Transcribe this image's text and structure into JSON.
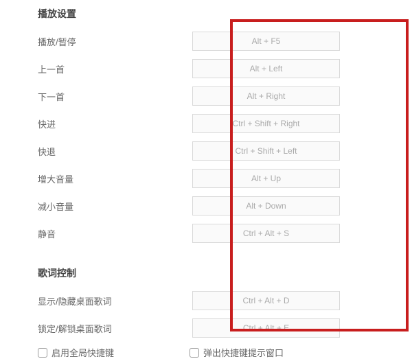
{
  "playback": {
    "title": "播放设置",
    "items": [
      {
        "label": "播放/暂停",
        "shortcut": "Alt + F5"
      },
      {
        "label": "上一首",
        "shortcut": "Alt + Left"
      },
      {
        "label": "下一首",
        "shortcut": "Alt + Right"
      },
      {
        "label": "快进",
        "shortcut": "Ctrl + Shift + Right"
      },
      {
        "label": "快退",
        "shortcut": "Ctrl + Shift + Left"
      },
      {
        "label": "增大音量",
        "shortcut": "Alt + Up"
      },
      {
        "label": "减小音量",
        "shortcut": "Alt + Down"
      },
      {
        "label": "静音",
        "shortcut": "Ctrl + Alt + S"
      }
    ]
  },
  "lyrics": {
    "title": "歌词控制",
    "items": [
      {
        "label": "显示/隐藏桌面歌词",
        "shortcut": "Ctrl + Alt + D"
      },
      {
        "label": "锁定/解锁桌面歌词",
        "shortcut": "Ctrl + Alt + E"
      }
    ]
  },
  "footer": {
    "enable_global": "启用全局快捷键",
    "show_popup": "弹出快捷键提示窗口"
  }
}
